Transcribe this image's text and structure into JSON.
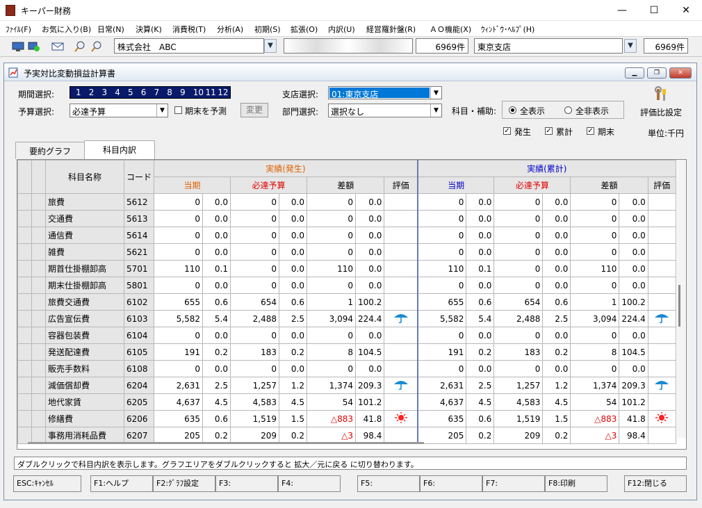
{
  "app": {
    "title": "キーパー財務"
  },
  "menu": [
    "ﾌｧｲﾙ(F)",
    "お気に入り(B)",
    "日常(N)",
    "決算(K)",
    "消費税(T)",
    "分析(A)",
    "初期(S)",
    "拡張(O)",
    "内訳(U)",
    "経営羅針盤(R)",
    "ＡＯ機能(X)",
    "ｳｨﾝﾄﾞｳ･ﾍﾙﾌﾟ(H)"
  ],
  "toolbar": {
    "company": "株式会社　ABC",
    "count1": "6969件",
    "branch": "東京支店",
    "count2": "6969件"
  },
  "window": {
    "title": "予実対比変動損益計算書"
  },
  "form": {
    "period_label": "期間選択:",
    "months": [
      "1",
      "2",
      "3",
      "4",
      "5",
      "6",
      "7",
      "8",
      "9",
      "10",
      "11",
      "12"
    ],
    "budget_label": "予算選択:",
    "budget_value": "必達予算",
    "forecast_label": "期末を予測",
    "change_btn": "変更",
    "branch_label": "支店選択:",
    "branch_value": "01:東京支店",
    "dept_label": "部門選択:",
    "dept_value": "選択なし",
    "account_label": "科目・補助:",
    "show_all": "全表示",
    "hide_all": "全非表示",
    "chk_hassei": "発生",
    "chk_ruikei": "累計",
    "chk_kimatsu": "期末",
    "eval_setting": "評価比設定",
    "unit": "単位:千円"
  },
  "tabs": [
    "要約グラフ",
    "科目内訳"
  ],
  "grid": {
    "h_name": "科目名称",
    "h_code": "コード",
    "h_group1": "実績(発生)",
    "h_group2": "実績(累計)",
    "h_current": "当期",
    "h_budget": "必達予算",
    "h_diff": "差額",
    "h_eval": "評価",
    "rows": [
      {
        "name": "旅費",
        "code": "5612",
        "c1": "0",
        "c2": "0.0",
        "b1": "0",
        "b2": "0.0",
        "d1": "0",
        "d2": "0.0",
        "e": ""
      },
      {
        "name": "交通費",
        "code": "5613",
        "c1": "0",
        "c2": "0.0",
        "b1": "0",
        "b2": "0.0",
        "d1": "0",
        "d2": "0.0",
        "e": ""
      },
      {
        "name": "通信費",
        "code": "5614",
        "c1": "0",
        "c2": "0.0",
        "b1": "0",
        "b2": "0.0",
        "d1": "0",
        "d2": "0.0",
        "e": ""
      },
      {
        "name": "雑費",
        "code": "5621",
        "c1": "0",
        "c2": "0.0",
        "b1": "0",
        "b2": "0.0",
        "d1": "0",
        "d2": "0.0",
        "e": ""
      },
      {
        "name": "期首仕掛棚卸高",
        "code": "5701",
        "c1": "110",
        "c2": "0.1",
        "b1": "0",
        "b2": "0.0",
        "d1": "110",
        "d2": "0.0",
        "e": ""
      },
      {
        "name": "期末仕掛棚卸高",
        "code": "5801",
        "c1": "0",
        "c2": "0.0",
        "b1": "0",
        "b2": "0.0",
        "d1": "0",
        "d2": "0.0",
        "e": ""
      },
      {
        "name": "旅費交通費",
        "code": "6102",
        "c1": "655",
        "c2": "0.6",
        "b1": "654",
        "b2": "0.6",
        "d1": "1",
        "d2": "100.2",
        "e": ""
      },
      {
        "name": "広告宣伝費",
        "code": "6103",
        "c1": "5,582",
        "c2": "5.4",
        "b1": "2,488",
        "b2": "2.5",
        "d1": "3,094",
        "d2": "224.4",
        "e": "umbrella"
      },
      {
        "name": "容器包装費",
        "code": "6104",
        "c1": "0",
        "c2": "0.0",
        "b1": "0",
        "b2": "0.0",
        "d1": "0",
        "d2": "0.0",
        "e": ""
      },
      {
        "name": "発送配達費",
        "code": "6105",
        "c1": "191",
        "c2": "0.2",
        "b1": "183",
        "b2": "0.2",
        "d1": "8",
        "d2": "104.5",
        "e": ""
      },
      {
        "name": "販売手数料",
        "code": "6108",
        "c1": "0",
        "c2": "0.0",
        "b1": "0",
        "b2": "0.0",
        "d1": "0",
        "d2": "0.0",
        "e": ""
      },
      {
        "name": "減価償却費",
        "code": "6204",
        "c1": "2,631",
        "c2": "2.5",
        "b1": "1,257",
        "b2": "1.2",
        "d1": "1,374",
        "d2": "209.3",
        "e": "umbrella"
      },
      {
        "name": "地代家賃",
        "code": "6205",
        "c1": "4,637",
        "c2": "4.5",
        "b1": "4,583",
        "b2": "4.5",
        "d1": "54",
        "d2": "101.2",
        "e": ""
      },
      {
        "name": "修繕費",
        "code": "6206",
        "c1": "635",
        "c2": "0.6",
        "b1": "1,519",
        "b2": "1.5",
        "d1": "△883",
        "d2": "41.8",
        "e": "sun",
        "neg": true
      },
      {
        "name": "事務用消耗品費",
        "code": "6207",
        "c1": "205",
        "c2": "0.2",
        "b1": "209",
        "b2": "0.2",
        "d1": "△3",
        "d2": "98.4",
        "e": "",
        "neg": true
      }
    ]
  },
  "status": "ダブルクリックで科目内訳を表示します。グラフエリアをダブルクリックすると 拡大／元に戻る に切り替わります。",
  "fkeys": [
    "ESC:ｷｬﾝｾﾙ",
    "F1:ヘルプ",
    "F2:ｸﾞﾗﾌ設定",
    "F3:",
    "F4:",
    "F5:",
    "F6:",
    "F7:",
    "F8:印刷",
    "F12:閉じる"
  ],
  "colors": {
    "accent": "#0000c8",
    "orange": "#e06000",
    "red": "#e00000",
    "umbrella": "#1a8ad4",
    "sun": "#ff2020"
  }
}
